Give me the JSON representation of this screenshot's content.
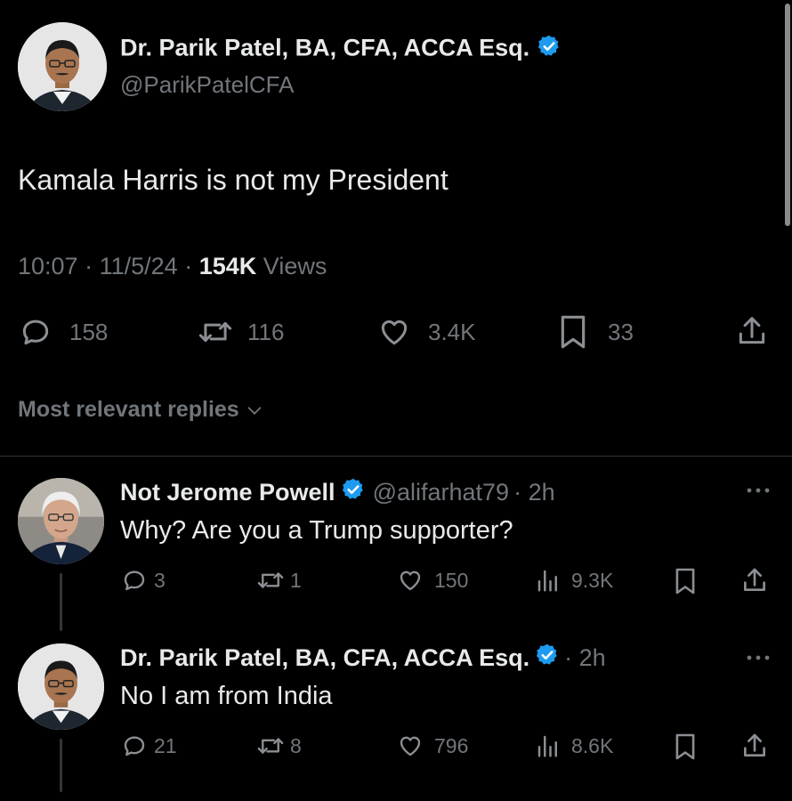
{
  "main_tweet": {
    "author_name": "Dr. Parik Patel, BA, CFA, ACCA Esq.",
    "author_handle": "@ParikPatelCFA",
    "text": "Kamala Harris is not my President",
    "time": "10:07",
    "date": "11/5/24",
    "separator": "·",
    "views_count": "154K",
    "views_label": "Views",
    "replies": "158",
    "reposts": "116",
    "likes": "3.4K",
    "bookmarks": "33"
  },
  "sort_label": "Most relevant replies",
  "replies": [
    {
      "author_name": "Not Jerome Powell",
      "author_handle": "@alifarhat79",
      "time": "· 2h",
      "text": "Why? Are you a Trump supporter?",
      "replies": "3",
      "reposts": "1",
      "likes": "150",
      "views": "9.3K"
    },
    {
      "author_name": "Dr. Parik Patel, BA, CFA, ACCA Esq.",
      "time": "· 2h",
      "text": "No I am from India",
      "replies": "21",
      "reposts": "8",
      "likes": "796",
      "views": "8.6K"
    }
  ],
  "colors": {
    "background": "#000000",
    "text": "#e7e9ea",
    "muted": "#71767b",
    "verified": "#1d9bf0"
  }
}
